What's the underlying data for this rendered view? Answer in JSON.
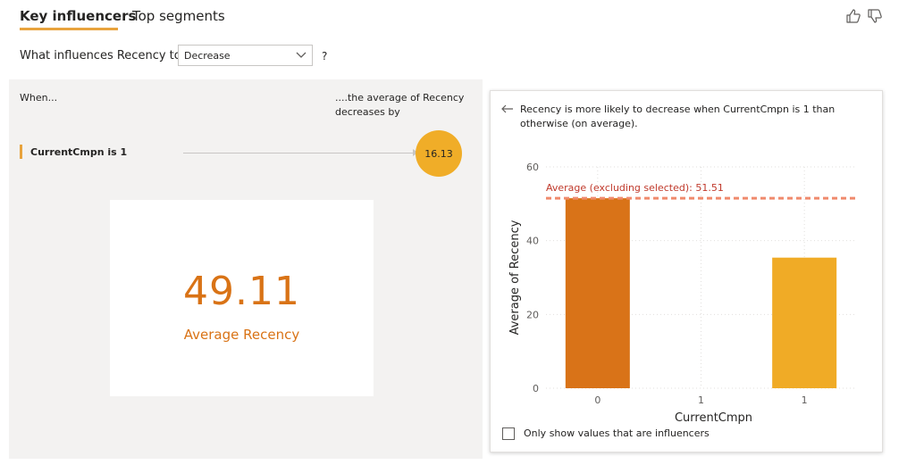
{
  "tabs": {
    "key_influencers": "Key influencers",
    "top_segments": "Top segments"
  },
  "toolbar": {
    "thumbs_up_icon": "thumbs-up-icon",
    "thumbs_down_icon": "thumbs-down-icon"
  },
  "question": {
    "label": "What influences Recency to",
    "dropdown_value": "Decrease",
    "help": "?"
  },
  "left_panel": {
    "when_label": "When...",
    "avg_header": "....the average of Recency decreases by",
    "influencer": {
      "label": "CurrentCmpn is 1",
      "value": "16.13"
    },
    "card": {
      "value": "49.11",
      "label": "Average Recency"
    }
  },
  "detail": {
    "text": "Recency is more likely to decrease when CurrentCmpn is 1 than otherwise (on average).",
    "checkbox_label": "Only show values that are influencers"
  },
  "colors": {
    "accent": "#e8a33d",
    "bar_dark": "#d97318",
    "bar_light": "#f0ab26",
    "avg_line": "#f08a6c",
    "avg_text": "#c0392b"
  },
  "chart_data": {
    "type": "bar",
    "categories": [
      "0",
      "1",
      "1"
    ],
    "values": [
      51.51,
      null,
      35.4
    ],
    "xlabel": "CurrentCmpn",
    "ylabel": "Average of Recency",
    "ylim": [
      0,
      60
    ],
    "yticks": [
      0,
      20,
      40,
      60
    ],
    "reference_line": {
      "label": "Average (excluding selected): 51.51",
      "value": 51.51
    },
    "bar_colors": [
      "#d97318",
      null,
      "#f0ab26"
    ],
    "grid": true
  }
}
